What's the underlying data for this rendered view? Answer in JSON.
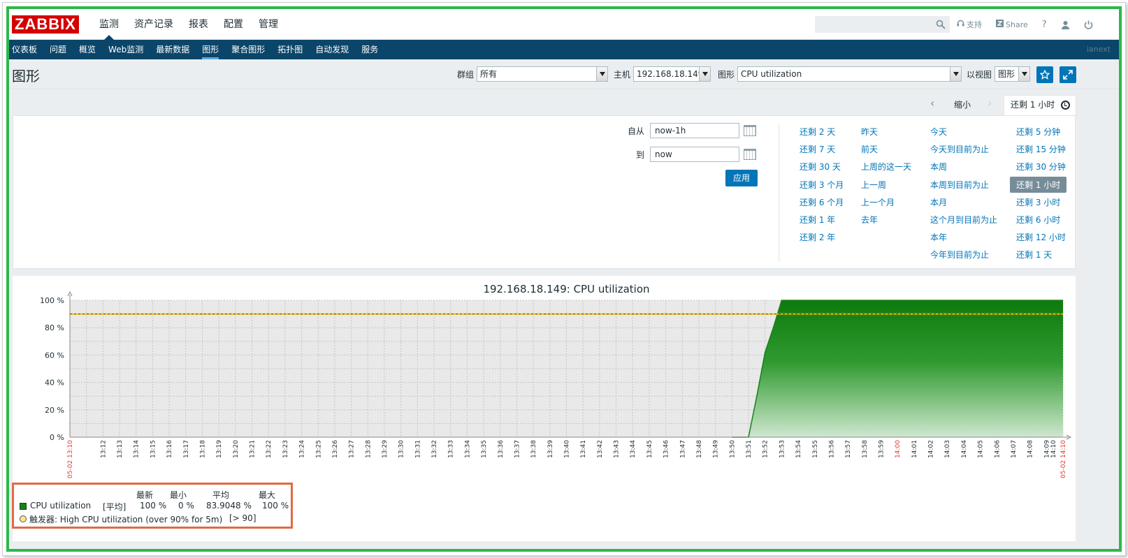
{
  "logo": "ZABBIX",
  "main_menu": [
    {
      "label": "监测",
      "active": true
    },
    {
      "label": "资产记录",
      "active": false
    },
    {
      "label": "报表",
      "active": false
    },
    {
      "label": "配置",
      "active": false
    },
    {
      "label": "管理",
      "active": false
    }
  ],
  "top_right": {
    "support": "支持",
    "share": "Share",
    "help": "?"
  },
  "sub_menu": [
    {
      "label": "仪表板",
      "active": false
    },
    {
      "label": "问题",
      "active": false
    },
    {
      "label": "概览",
      "active": false
    },
    {
      "label": "Web监测",
      "active": false
    },
    {
      "label": "最新数据",
      "active": false
    },
    {
      "label": "图形",
      "active": true
    },
    {
      "label": "聚合图形",
      "active": false
    },
    {
      "label": "拓扑图",
      "active": false
    },
    {
      "label": "自动发现",
      "active": false
    },
    {
      "label": "服务",
      "active": false
    }
  ],
  "user": "ianext",
  "page": {
    "title": "图形",
    "filters": {
      "group_label": "群组",
      "group_value": "所有",
      "host_label": "主机",
      "host_value": "192.168.18.149",
      "graph_label": "图形",
      "graph_value": "CPU utilization",
      "view_label": "以视图",
      "view_value": "图形"
    }
  },
  "time_tabs": {
    "zoom_out": "缩小",
    "active": "还剩 1 小时"
  },
  "time_panel": {
    "from_label": "自从",
    "from_value": "now-1h",
    "to_label": "到",
    "to_value": "now",
    "apply": "应用",
    "quick": [
      [
        "还剩 2 天",
        "还剩 7 天",
        "还剩 30 天",
        "还剩 3 个月",
        "还剩 6 个月",
        "还剩 1 年",
        "还剩 2 年"
      ],
      [
        "昨天",
        "前天",
        "上周的这一天",
        "上一周",
        "上一个月",
        "去年"
      ],
      [
        "今天",
        "今天到目前为止",
        "本周",
        "本周到目前为止",
        "本月",
        "这个月到目前为止",
        "本年",
        "今年到目前为止"
      ],
      [
        "还剩 5 分钟",
        "还剩 15 分钟",
        "还剩 30 分钟",
        "还剩 1 小时",
        "还剩 3 小时",
        "还剩 6 小时",
        "还剩 12 小时",
        "还剩 1 天"
      ]
    ],
    "selected": "还剩 1 小时"
  },
  "chart_data": {
    "type": "area",
    "title": "192.168.18.149: CPU utilization",
    "y_ticks": [
      "100 %",
      "80 %",
      "60 %",
      "40 %",
      "20 %",
      "0 %"
    ],
    "ylim": [
      0,
      100
    ],
    "x_start_label": "05-02 13:10",
    "x_end_label": "05-02 14:10",
    "x_ticks": [
      "13:12",
      "13:13",
      "13:14",
      "13:15",
      "13:16",
      "13:17",
      "13:18",
      "13:19",
      "13:20",
      "13:21",
      "13:22",
      "13:23",
      "13:24",
      "13:25",
      "13:26",
      "13:27",
      "13:28",
      "13:29",
      "13:30",
      "13:31",
      "13:32",
      "13:33",
      "13:34",
      "13:35",
      "13:36",
      "13:37",
      "13:38",
      "13:39",
      "13:40",
      "13:41",
      "13:42",
      "13:43",
      "13:44",
      "13:45",
      "13:46",
      "13:47",
      "13:48",
      "13:49",
      "13:50",
      "13:51",
      "13:52",
      "13:53",
      "13:54",
      "13:55",
      "13:56",
      "13:57",
      "13:58",
      "13:59",
      "14:00",
      "14:01",
      "14:02",
      "14:03",
      "14:04",
      "14:05",
      "14:06",
      "14:07",
      "14:08",
      "14:09",
      "14:10"
    ],
    "highlight_tick": "14:00",
    "series": [
      {
        "name": "CPU utilization",
        "color": "#1a7f1a",
        "x": [
          "13:50",
          "13:51",
          "13:51.5",
          "13:52",
          "13:52.5",
          "13:53",
          "14:10"
        ],
        "values": [
          0,
          0,
          30,
          62,
          80,
          100,
          100
        ]
      }
    ],
    "threshold": {
      "value": 90,
      "color": "#c8a000"
    },
    "legend": {
      "headers": [
        "最新",
        "最小",
        "平均",
        "最大"
      ],
      "series_name": "CPU utilization",
      "func": "[平均]",
      "last": "100 %",
      "min": "0 %",
      "avg": "83.9048 %",
      "max": "100 %",
      "trigger": "触发器: High CPU utilization (over 90% for 5m)",
      "trigger_cond": "[> 90]"
    }
  }
}
